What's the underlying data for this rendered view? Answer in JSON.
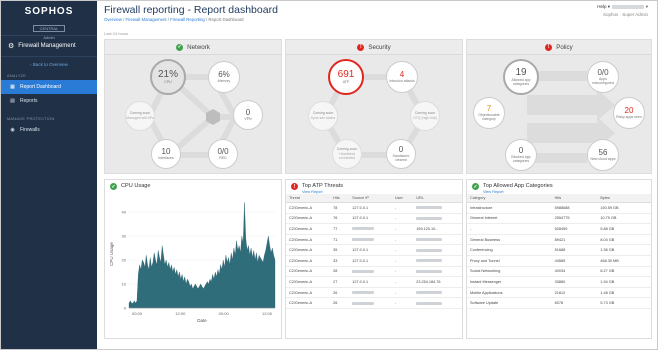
{
  "sidebar": {
    "logo": "SOPHOS",
    "logo_sub": "CENTRAL",
    "logo_admin": "Admin",
    "title": "Firewall Management",
    "back": "Back to Overview",
    "sections": [
      {
        "label": "ANALYZE",
        "items": [
          {
            "label": "Report Dashboard",
            "icon": "dashboard-icon",
            "active": true
          },
          {
            "label": "Reports",
            "icon": "reports-icon",
            "active": false
          }
        ]
      },
      {
        "label": "MANAGE PROTECTION",
        "items": [
          {
            "label": "Firewalls",
            "icon": "firewall-icon",
            "active": false
          }
        ]
      }
    ]
  },
  "header": {
    "title": "Firewall reporting - Report dashboard",
    "breadcrumb": [
      "Overview",
      "Firewall Management",
      "Firewall Reporting",
      "Report Dashboard"
    ],
    "help": "Help ▾",
    "user_sub": "Sophos · Super Admin",
    "last_updated": "Last 24 hours"
  },
  "network": {
    "title": "Network",
    "status": "ok",
    "cpu": {
      "value": "21%",
      "label": "CPU"
    },
    "memory": {
      "value": "6%",
      "label": "Memory"
    },
    "vpn": {
      "value": "0",
      "label": "VPN"
    },
    "red": {
      "value": "0/0",
      "label": "RED"
    },
    "interfaces": {
      "value": "10",
      "label": "Interfaces"
    },
    "soon_left": {
      "title": "Coming soon",
      "text": "Managed wifi APs"
    }
  },
  "security": {
    "title": "Security",
    "status": "bad",
    "atp": {
      "value": "691",
      "label": "ATP"
    },
    "intrusion": {
      "value": "4",
      "label": "Intrusion attacks"
    },
    "sandstorm": {
      "value": "0",
      "label": "Sandstorm cleared"
    },
    "soon_left": {
      "title": "Coming soon",
      "text": "Sync sec status"
    },
    "soon_right": {
      "title": "Coming soon",
      "text": "UTQ (high risk)"
    },
    "soon_bottom": {
      "title": "Coming soon",
      "text": "Heartbeat connected"
    }
  },
  "policy": {
    "title": "Policy",
    "status": "bad",
    "allowed": {
      "value": "19",
      "label": "Allowed app categories"
    },
    "apps": {
      "value": "0/0",
      "label": "Apps misconfigured"
    },
    "objectionable": {
      "value": "7",
      "label": "Objectionable category"
    },
    "risky": {
      "value": "20",
      "label": "Risky apps seen"
    },
    "blocked": {
      "value": "0",
      "label": "Blocked app categories"
    },
    "cloud": {
      "value": "56",
      "label": "New cloud apps"
    }
  },
  "cpu_usage": {
    "title": "CPU Usage",
    "chart_data": {
      "type": "area",
      "ylabel": "CPU Usage",
      "xlabel": "Date",
      "ylim": [
        0,
        45
      ],
      "yticks": [
        0,
        10,
        20,
        30,
        40
      ],
      "xtick_labels": [
        "00:00",
        "12:00",
        "00:00",
        "12:00"
      ],
      "series": [
        {
          "values": [
            2,
            3,
            2,
            2,
            3,
            2,
            3,
            14,
            18,
            16,
            20,
            19,
            17,
            22,
            18,
            16,
            21,
            17,
            19,
            23,
            20,
            18,
            24,
            21,
            19,
            26,
            22,
            18,
            20,
            17,
            19,
            16,
            18,
            15,
            17,
            14,
            16,
            13,
            15,
            12,
            14,
            11,
            13,
            10,
            12,
            11,
            9,
            10,
            8,
            9,
            10,
            9,
            8,
            9,
            10,
            9,
            8,
            9,
            10,
            11,
            10,
            12,
            11,
            14,
            12,
            15,
            13,
            16,
            14,
            18,
            16,
            20,
            17,
            22,
            19,
            21,
            18,
            23,
            20,
            25,
            22,
            28,
            24,
            26,
            23,
            30,
            27,
            44,
            29,
            24,
            26,
            22,
            25,
            21,
            24,
            20,
            23,
            19,
            22,
            21,
            20,
            19,
            22,
            24,
            27,
            30,
            26,
            23,
            25,
            22,
            20
          ]
        }
      ]
    }
  },
  "atp_threats": {
    "title": "Top ATP Threats",
    "link": "View Report",
    "columns": [
      "Threat",
      "Hits",
      "Source IP",
      "User",
      "URL"
    ],
    "rows": [
      [
        "C2/Generic-A",
        "78",
        "127.0.0.1",
        "-",
        ""
      ],
      [
        "C2/Generic-A",
        "76",
        "127.0.0.1",
        "-",
        ""
      ],
      [
        "C2/Generic-A",
        "77",
        "",
        "-",
        "159.120.10..."
      ],
      [
        "C2/Generic-A",
        "71",
        "",
        "-",
        ""
      ],
      [
        "C2/Generic-A",
        "35",
        "127.0.0.1",
        "-",
        ""
      ],
      [
        "C2/Generic-A",
        "33",
        "127.0.0.1",
        "-",
        ""
      ],
      [
        "C2/Generic-A",
        "28",
        "",
        "-",
        ""
      ],
      [
        "C2/Generic-A",
        "27",
        "127.0.0.1",
        "-",
        "23.254.184.76"
      ],
      [
        "C2/Generic-A",
        "26",
        "",
        "-",
        ""
      ],
      [
        "C2/Generic-A",
        "26",
        "",
        "-",
        ""
      ]
    ]
  },
  "app_categories": {
    "title": "Top Allowed App Categories",
    "link": "View Report",
    "columns": [
      "Category",
      "Hits",
      "Bytes"
    ],
    "rows": [
      [
        "Infrastructure",
        "5988688",
        "150.59 GB"
      ],
      [
        "General Internet",
        "2554775",
        "10.79 GB"
      ],
      [
        "-",
        "528459",
        "5.88 GB"
      ],
      [
        "General Business",
        "89421",
        "8.04 GB"
      ],
      [
        "Conferencing",
        "51688",
        "1.36 GB"
      ],
      [
        "Proxy and Tunnel",
        "44585",
        "468.30 MB"
      ],
      [
        "Social Networking",
        "40034",
        "8.27 GB"
      ],
      [
        "Instant Messenger",
        "33880",
        "1.94 GB"
      ],
      [
        "Mobile Applications",
        "21812",
        "1.48 GB"
      ],
      [
        "Software Update",
        "6078",
        "5.73 GB"
      ]
    ]
  },
  "colors": {
    "sidebar": "#1f3047",
    "accent": "#2a7bd6",
    "ok": "#3fa34d",
    "bad": "#e0271f",
    "area": "#2f6d7a"
  }
}
